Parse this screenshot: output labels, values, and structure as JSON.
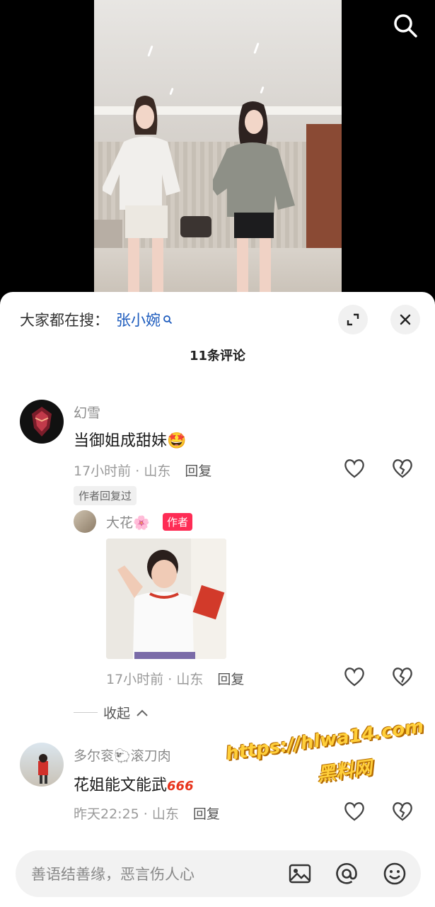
{
  "video": {},
  "hot_search": {
    "prefix": "大家都在搜：",
    "term": "张小婉"
  },
  "comments_count": "11条评论",
  "comments": [
    {
      "username": "幻雪",
      "text": "当御姐成甜妹🤩",
      "time": "17小时前",
      "location": "山东",
      "reply_label": "回复",
      "author_replied_tag": "作者回复过",
      "replies": [
        {
          "username": "大花🌸",
          "badge": "作者",
          "time": "17小时前",
          "location": "山东",
          "reply_label": "回复"
        }
      ],
      "collapse_label": "收起"
    },
    {
      "username": "多尔衮🐑滚刀肉",
      "text": "花姐能文能武",
      "text_emoji": "666",
      "time": "昨天22:25",
      "location": "山东",
      "reply_label": "回复"
    }
  ],
  "watermark": {
    "line1": "https://hlwa14.com",
    "line2": "黑料网"
  },
  "input": {
    "placeholder": "善语结善缘，恶言伤人心"
  },
  "colors": {
    "accent_link": "#1c5bbd",
    "author_badge": "#fe2c55",
    "watermark": "#ffcf3a"
  },
  "icons": [
    "search-icon",
    "expand-icon",
    "close-icon",
    "heart-icon",
    "broken-heart-icon",
    "chevron-up-icon",
    "image-icon",
    "at-icon",
    "emoji-icon"
  ]
}
